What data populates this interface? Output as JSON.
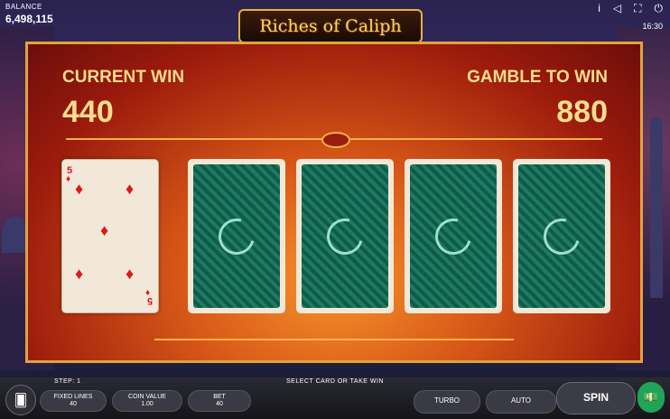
{
  "header": {
    "balance_label": "BALANCE",
    "balance_value": "6,498,115",
    "logo_text": "Riches of Caliph",
    "clock": "16:30",
    "icons": [
      "info-icon",
      "sound-icon",
      "fullscreen-icon",
      "power-icon"
    ]
  },
  "gamble": {
    "current_win_label": "CURRENT WIN",
    "current_win_value": "440",
    "gamble_to_win_label": "GAMBLE TO WIN",
    "gamble_to_win_value": "880",
    "open_card": {
      "rank": "5",
      "suit": "diamonds"
    },
    "hidden_cards_count": 4
  },
  "footer": {
    "step": "STEP: 1",
    "message": "SELECT CARD OR TAKE WIN",
    "fixed_lines_label": "FIXED LINES",
    "fixed_lines_value": "40",
    "coin_value_label": "COIN VALUE",
    "coin_value_value": "1.00",
    "bet_label": "BET",
    "bet_value": "40",
    "turbo_label": "TURBO",
    "auto_label": "AUTO",
    "spin_label": "SPIN"
  },
  "colors": {
    "gold": "#f7dd8c",
    "card_back": "#1a6a56",
    "panel_red": "#9a1a0c",
    "money_green": "#1fa45a"
  }
}
